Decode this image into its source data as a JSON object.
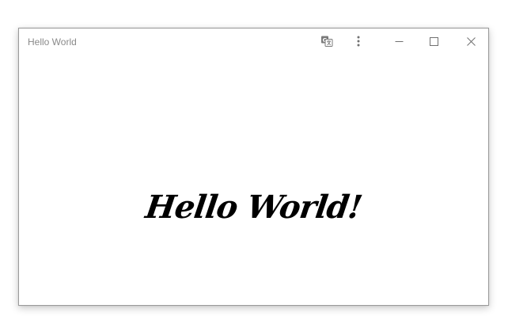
{
  "window": {
    "title": "Hello World"
  },
  "titlebar": {
    "buttons": [
      {
        "name": "translate-icon"
      },
      {
        "name": "more-vertical-icon"
      },
      {
        "name": "minimize-icon"
      },
      {
        "name": "maximize-icon"
      },
      {
        "name": "close-icon"
      }
    ]
  },
  "content": {
    "greeting": "Hello World!"
  },
  "colors": {
    "window_border": "#9a9a9a",
    "title_text": "#8a8a8a",
    "icon": "#707070",
    "greeting_text": "#000000"
  }
}
